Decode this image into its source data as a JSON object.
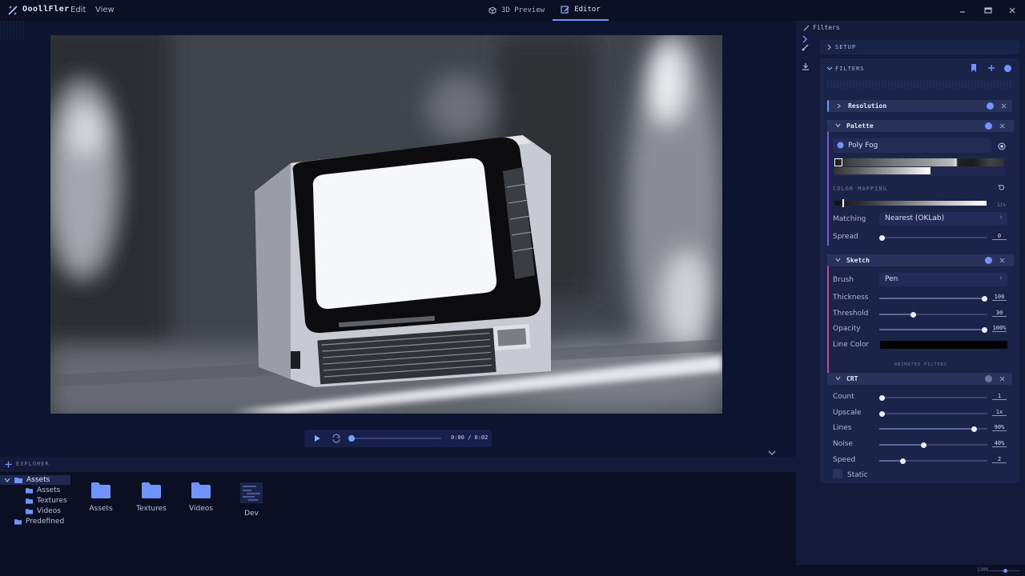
{
  "app": {
    "name": "OoollFler"
  },
  "menu": {
    "edit": "Edit",
    "view": "View"
  },
  "tabs": [
    {
      "label": "3D Preview"
    },
    {
      "label": "Editor"
    }
  ],
  "player": {
    "time": "0:00 / 0:02",
    "progress": 0.0
  },
  "explorer": {
    "title": "EXPLORER",
    "tree": {
      "root": "Assets",
      "children": [
        "Assets",
        "Textures",
        "Videos"
      ],
      "predefined": "Predefined"
    },
    "tiles": [
      "Assets",
      "Textures",
      "Videos",
      "Dev"
    ]
  },
  "panel": {
    "title": "Filters",
    "setup_label": "SETUP",
    "filters_label": "FILTERS",
    "animated_label": "ANIMATED FILTERS",
    "resolution": {
      "name": "Resolution"
    },
    "palette": {
      "name": "Palette",
      "preset": "Poly Fog",
      "color_mapping_label": "COLOR MAPPING",
      "mapping_value": "11%",
      "matching_label": "Matching",
      "matching_value": "Nearest (OKLab)",
      "spread_label": "Spread",
      "spread_value": "0",
      "spread_level": 0.0
    },
    "sketch": {
      "name": "Sketch",
      "brush_label": "Brush",
      "brush_value": "Pen",
      "thickness_label": "Thickness",
      "thickness_value": "100",
      "thickness_level": 1.0,
      "threshold_label": "Threshold",
      "threshold_value": "30",
      "threshold_level": 0.3,
      "opacity_label": "Opacity",
      "opacity_value": "100%",
      "opacity_level": 1.0,
      "line_color_label": "Line Color",
      "line_color": "#000000"
    },
    "crt": {
      "name": "CRT",
      "count_label": "Count",
      "count_value": "1",
      "count_level": 0.0,
      "upscale_label": "Upscale",
      "upscale_value": "1x",
      "upscale_level": 0.0,
      "lines_label": "Lines",
      "lines_value": "90%",
      "lines_level": 0.9,
      "noise_label": "Noise",
      "noise_value": "40%",
      "noise_level": 0.4,
      "speed_label": "Speed",
      "speed_value": "2",
      "speed_level": 0.2,
      "static_label": "Static"
    }
  },
  "footer": {
    "zoom": "130%"
  },
  "colors": {
    "accent": "#6f93ff",
    "panel": "#141b3a",
    "card": "#1a2348",
    "bg": "#0b1024"
  }
}
